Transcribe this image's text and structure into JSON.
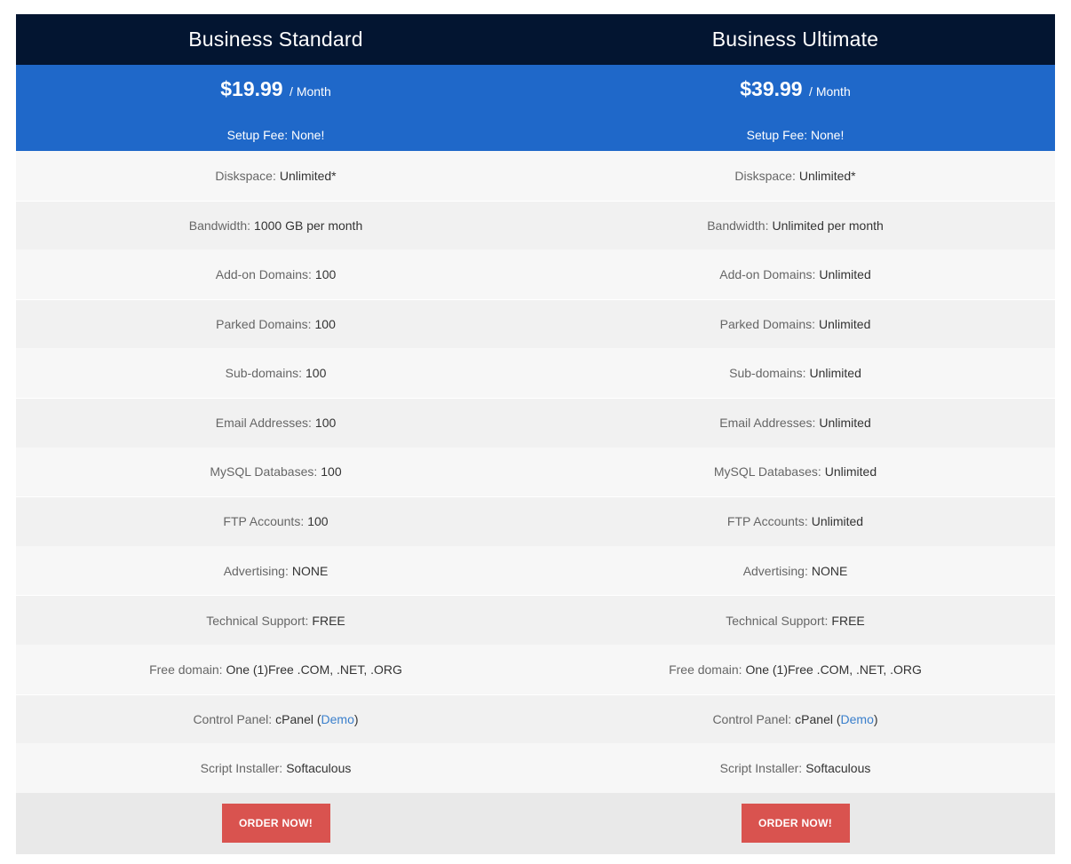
{
  "plans": [
    {
      "title": "Business Standard",
      "price": "$19.99",
      "period": "/ Month",
      "setup_fee": "Setup Fee: None!",
      "features": [
        {
          "label": "Diskspace:",
          "value": "Unlimited*"
        },
        {
          "label": "Bandwidth:",
          "value": "1000 GB per month"
        },
        {
          "label": "Add-on Domains:",
          "value": "100"
        },
        {
          "label": "Parked Domains:",
          "value": "100"
        },
        {
          "label": "Sub-domains:",
          "value": "100"
        },
        {
          "label": "Email Addresses:",
          "value": "100"
        },
        {
          "label": "MySQL Databases:",
          "value": "100"
        },
        {
          "label": "FTP Accounts:",
          "value": "100"
        },
        {
          "label": "Advertising:",
          "value": "NONE"
        },
        {
          "label": "Technical Support:",
          "value": "FREE"
        },
        {
          "label": "Free domain:",
          "value": "One (1)Free .COM, .NET, .ORG"
        }
      ],
      "control_panel": {
        "label": "Control Panel:",
        "value": "cPanel (",
        "link": "Demo",
        "suffix": ")"
      },
      "script_installer": {
        "label": "Script Installer:",
        "value": "Softaculous"
      },
      "order_label": "ORDER NOW!"
    },
    {
      "title": "Business Ultimate",
      "price": "$39.99",
      "period": "/ Month",
      "setup_fee": "Setup Fee: None!",
      "features": [
        {
          "label": "Diskspace:",
          "value": "Unlimited*"
        },
        {
          "label": "Bandwidth:",
          "value": "Unlimited per month"
        },
        {
          "label": "Add-on Domains:",
          "value": "Unlimited"
        },
        {
          "label": "Parked Domains:",
          "value": "Unlimited"
        },
        {
          "label": "Sub-domains:",
          "value": "Unlimited"
        },
        {
          "label": "Email Addresses:",
          "value": "Unlimited"
        },
        {
          "label": "MySQL Databases:",
          "value": "Unlimited"
        },
        {
          "label": "FTP Accounts:",
          "value": "Unlimited"
        },
        {
          "label": "Advertising:",
          "value": "NONE"
        },
        {
          "label": "Technical Support:",
          "value": "FREE"
        },
        {
          "label": "Free domain:",
          "value": "One (1)Free .COM, .NET, .ORG"
        }
      ],
      "control_panel": {
        "label": "Control Panel:",
        "value": "cPanel (",
        "link": "Demo",
        "suffix": ")"
      },
      "script_installer": {
        "label": "Script Installer:",
        "value": "Softaculous"
      },
      "order_label": "ORDER NOW!"
    }
  ],
  "colors": {
    "header_bg": "#031531",
    "price_bg": "#1f68c9",
    "row_light": "#f7f7f7",
    "row_dark": "#f1f1f1",
    "order_bg": "#e9e9e9",
    "button_bg": "#d9534f",
    "link": "#3a7fcc"
  }
}
